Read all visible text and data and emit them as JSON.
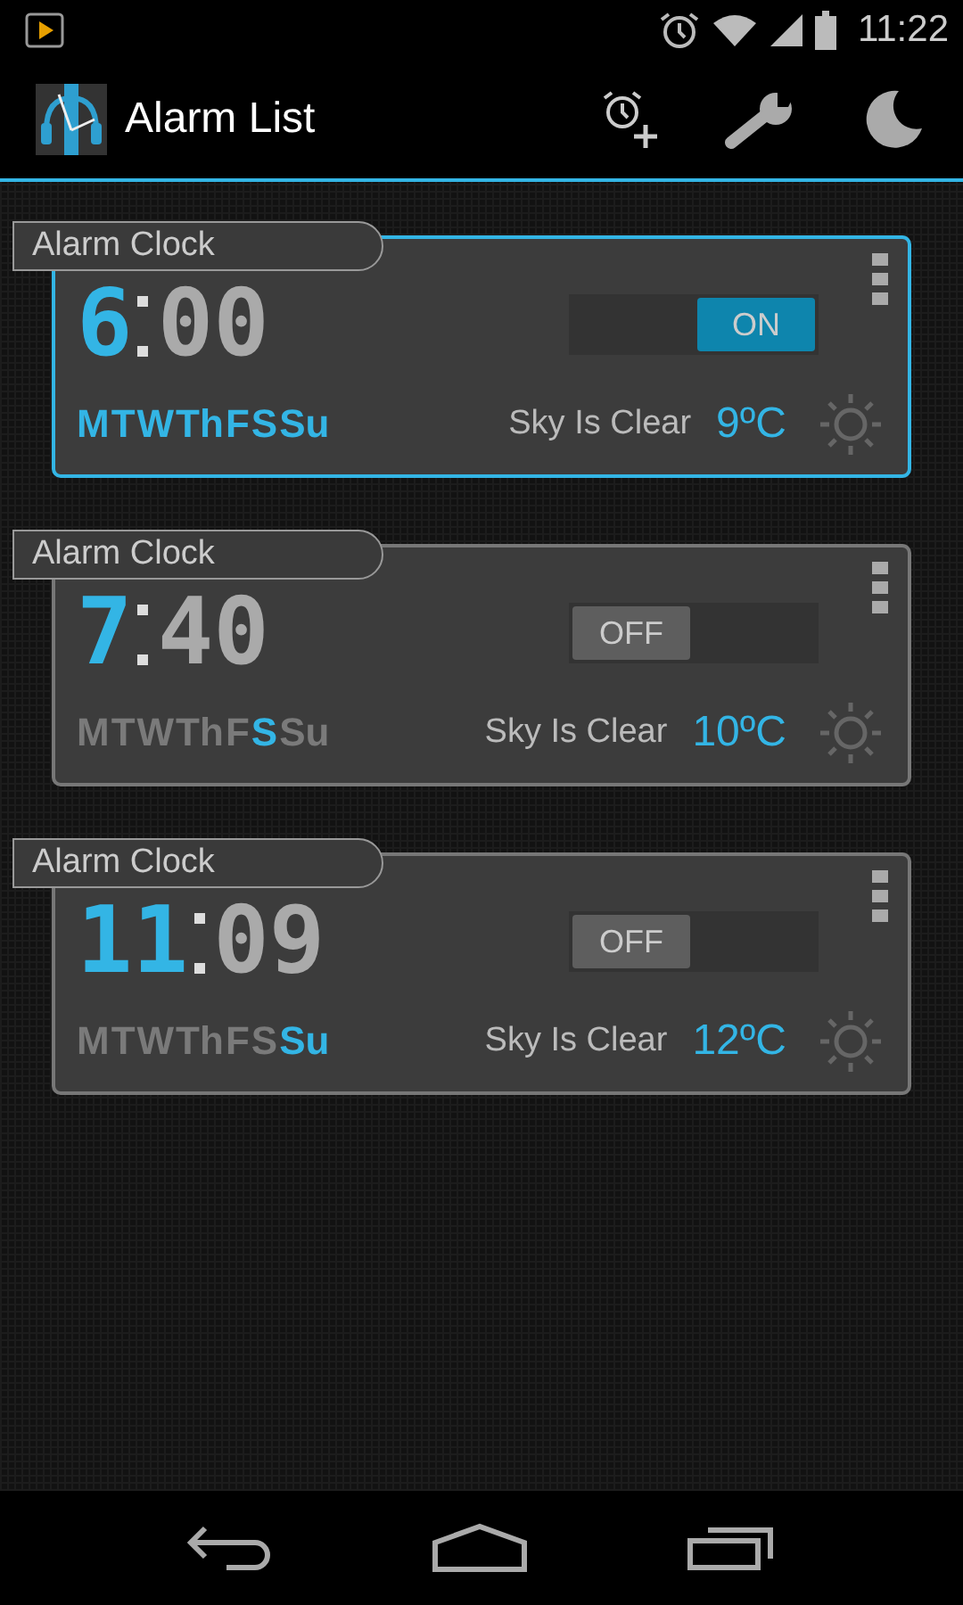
{
  "status_bar": {
    "time": "11:22"
  },
  "action_bar": {
    "title": "Alarm List"
  },
  "alarms": [
    {
      "label": "Alarm Clock",
      "hour": "6",
      "minute": "00",
      "on": true,
      "toggle": "ON",
      "weather": "Sky Is Clear",
      "temperature": "9ºC",
      "days": [
        {
          "label": "M",
          "on": true
        },
        {
          "label": "T",
          "on": true
        },
        {
          "label": "W",
          "on": true
        },
        {
          "label": "Th",
          "on": true
        },
        {
          "label": "F",
          "on": true
        },
        {
          "label": "S",
          "on": true
        },
        {
          "label": "Su",
          "on": true
        }
      ]
    },
    {
      "label": "Alarm Clock",
      "hour": "7",
      "minute": "40",
      "on": false,
      "toggle": "OFF",
      "weather": "Sky Is Clear",
      "temperature": "10ºC",
      "days": [
        {
          "label": "M",
          "on": false
        },
        {
          "label": "T",
          "on": false
        },
        {
          "label": "W",
          "on": false
        },
        {
          "label": "Th",
          "on": false
        },
        {
          "label": "F",
          "on": false
        },
        {
          "label": "S",
          "on": true
        },
        {
          "label": "Su",
          "on": false
        }
      ]
    },
    {
      "label": "Alarm Clock",
      "hour": "11",
      "minute": "09",
      "on": false,
      "toggle": "OFF",
      "weather": "Sky Is Clear",
      "temperature": "12ºC",
      "days": [
        {
          "label": "M",
          "on": false
        },
        {
          "label": "T",
          "on": false
        },
        {
          "label": "W",
          "on": false
        },
        {
          "label": "Th",
          "on": false
        },
        {
          "label": "F",
          "on": false
        },
        {
          "label": "S",
          "on": false
        },
        {
          "label": "Su",
          "on": true
        }
      ]
    }
  ]
}
